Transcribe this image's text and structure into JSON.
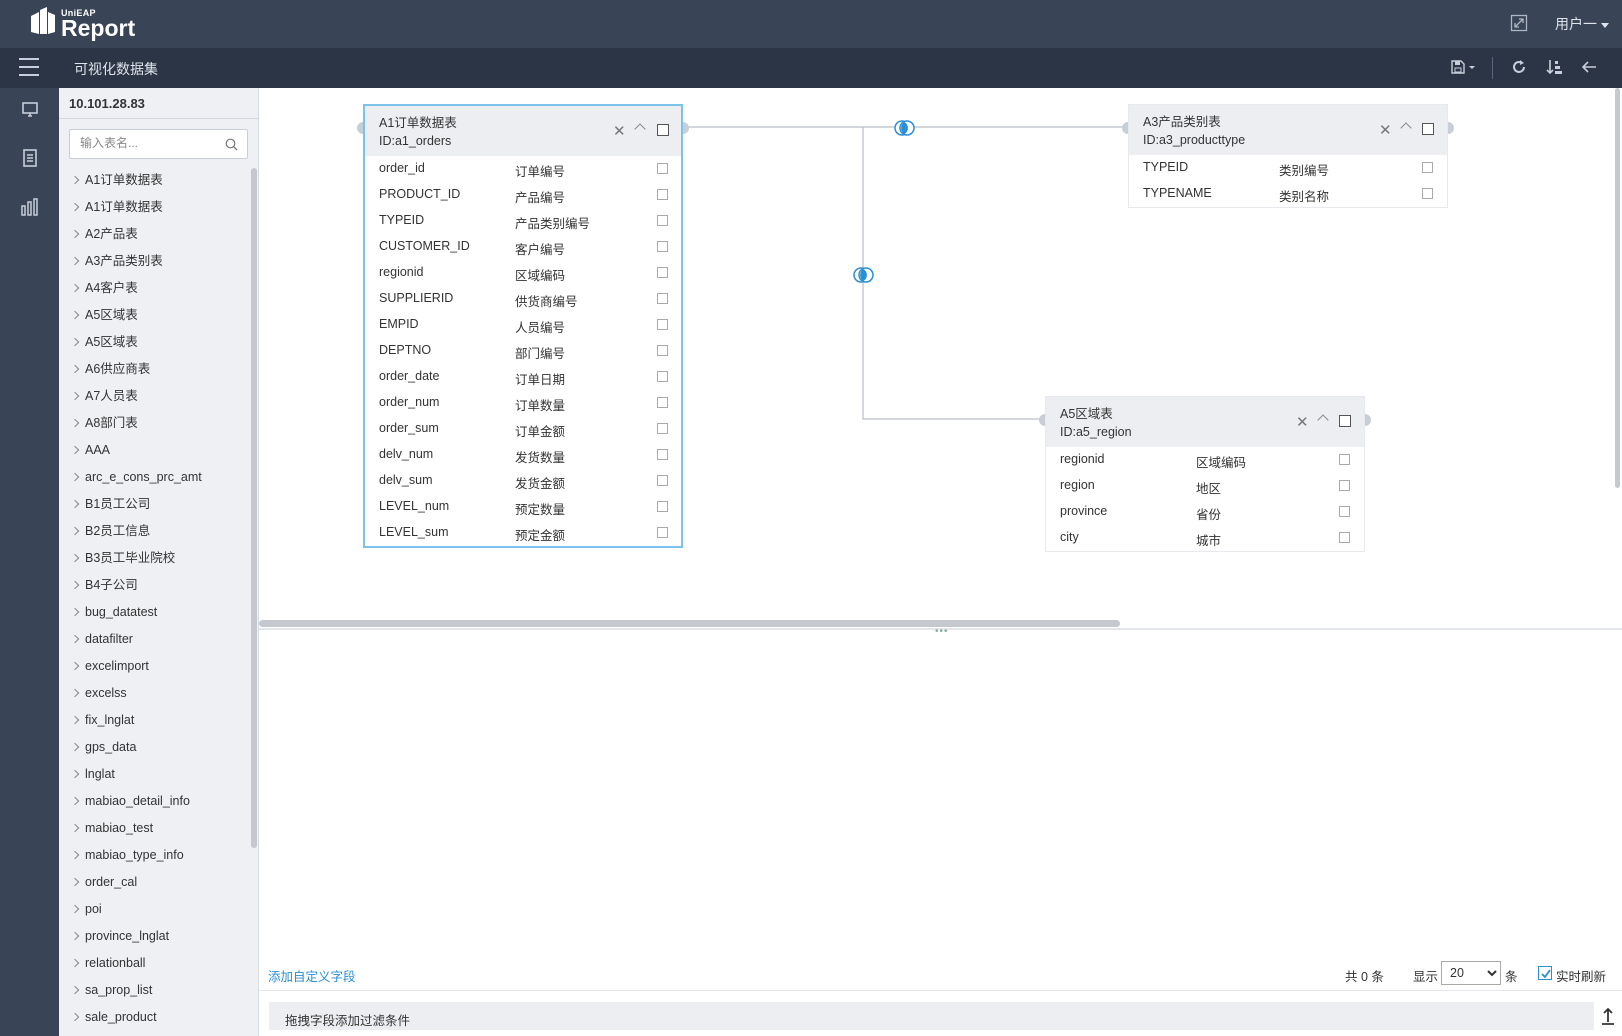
{
  "app": {
    "brand_small": "UniEAP",
    "brand_big": "Report",
    "user": "用户一"
  },
  "header": {
    "title": "可视化数据集"
  },
  "panel": {
    "server": "10.101.28.83",
    "search_placeholder": "输入表名...",
    "items": [
      "A1订单数据表",
      "A1订单数据表",
      "A2产品表",
      "A3产品类别表",
      "A4客户表",
      "A5区域表",
      "A5区域表",
      "A6供应商表",
      "A7人员表",
      "A8部门表",
      "AAA",
      "arc_e_cons_prc_amt",
      "B1员工公司",
      "B2员工信息",
      "B3员工毕业院校",
      "B4子公司",
      "bug_datatest",
      "datafilter",
      "excelimport",
      "excelss",
      "fix_lnglat",
      "gps_data",
      "lnglat",
      "mabiao_detail_info",
      "mabiao_test",
      "mabiao_type_info",
      "order_cal",
      "poi",
      "province_lnglat",
      "relationball",
      "sa_prop_list",
      "sale_product"
    ]
  },
  "tables": {
    "orders": {
      "name": "A1订单数据表",
      "id": "ID:a1_orders",
      "fields": [
        [
          "order_id",
          "订单编号"
        ],
        [
          "PRODUCT_ID",
          "产品编号"
        ],
        [
          "TYPEID",
          "产品类别编号"
        ],
        [
          "CUSTOMER_ID",
          "客户编号"
        ],
        [
          "regionid",
          "区域编码"
        ],
        [
          "SUPPLIERID",
          "供货商编号"
        ],
        [
          "EMPID",
          "人员编号"
        ],
        [
          "DEPTNO",
          "部门编号"
        ],
        [
          "order_date",
          "订单日期"
        ],
        [
          "order_num",
          "订单数量"
        ],
        [
          "order_sum",
          "订单金额"
        ],
        [
          "delv_num",
          "发货数量"
        ],
        [
          "delv_sum",
          "发货金额"
        ],
        [
          "LEVEL_num",
          "预定数量"
        ],
        [
          "LEVEL_sum",
          "预定金额"
        ]
      ]
    },
    "producttype": {
      "name": "A3产品类别表",
      "id": "ID:a3_producttype",
      "fields": [
        [
          "TYPEID",
          "类别编号"
        ],
        [
          "TYPENAME",
          "类别名称"
        ]
      ]
    },
    "region": {
      "name": "A5区域表",
      "id": "ID:a5_region",
      "fields": [
        [
          "regionid",
          "区域编码"
        ],
        [
          "region",
          "地区"
        ],
        [
          "province",
          "省份"
        ],
        [
          "city",
          "城市"
        ]
      ]
    }
  },
  "bottom": {
    "add_field": "添加自定义字段",
    "total": "共 0 条",
    "show": "显示",
    "page_size": "20",
    "page_size_options": [
      "20"
    ],
    "unit": "条",
    "realtime": "实时刷新",
    "filter_hint": "拖拽字段添加过滤条件"
  },
  "colors": {
    "topbar": "#394457",
    "subbar": "#2c3545",
    "accent": "#2a8fd4",
    "link_line": "#b9bfc8"
  }
}
